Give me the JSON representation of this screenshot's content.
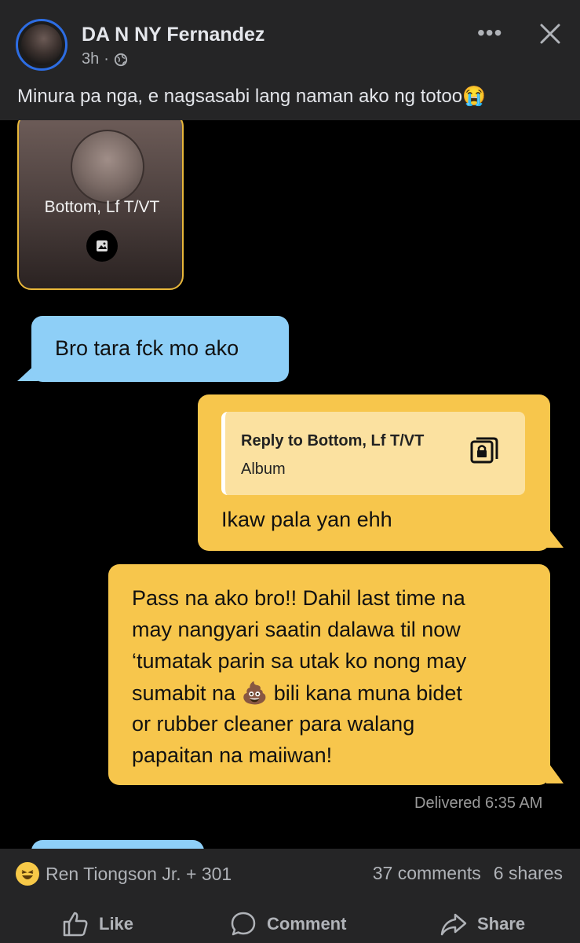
{
  "post": {
    "author": "DA N NY Fernandez",
    "time": "3h",
    "caption": "Minura pa nga, e nagsasabi lang naman ako ng totoo😭",
    "more_label": "•••"
  },
  "screenshot": {
    "profile_card_name": "Bottom, Lf T/VT",
    "incoming_message": "Bro tara fck mo ako",
    "reply_title": "Reply to Bottom, Lf T/VT",
    "reply_sub": "Album",
    "reply_text": "Ikaw  pala yan ehh",
    "long_message_lines": [
      "Pass na ako bro!! Dahil last time na",
      "may nangyari saatin dalawa til now",
      "‘tumatak parin sa utak ko nong may",
      "sumabit na 💩 bili kana muna bidet",
      "or rubber cleaner para walang",
      "papaitan na maiiwan!"
    ],
    "delivered": "Delivered 6:35 AM"
  },
  "footer": {
    "reactors": "Ren Tiongson Jr. + 301",
    "comments": "37 comments",
    "shares": "6 shares",
    "like_label": "Like",
    "comment_label": "Comment",
    "share_label": "Share"
  }
}
